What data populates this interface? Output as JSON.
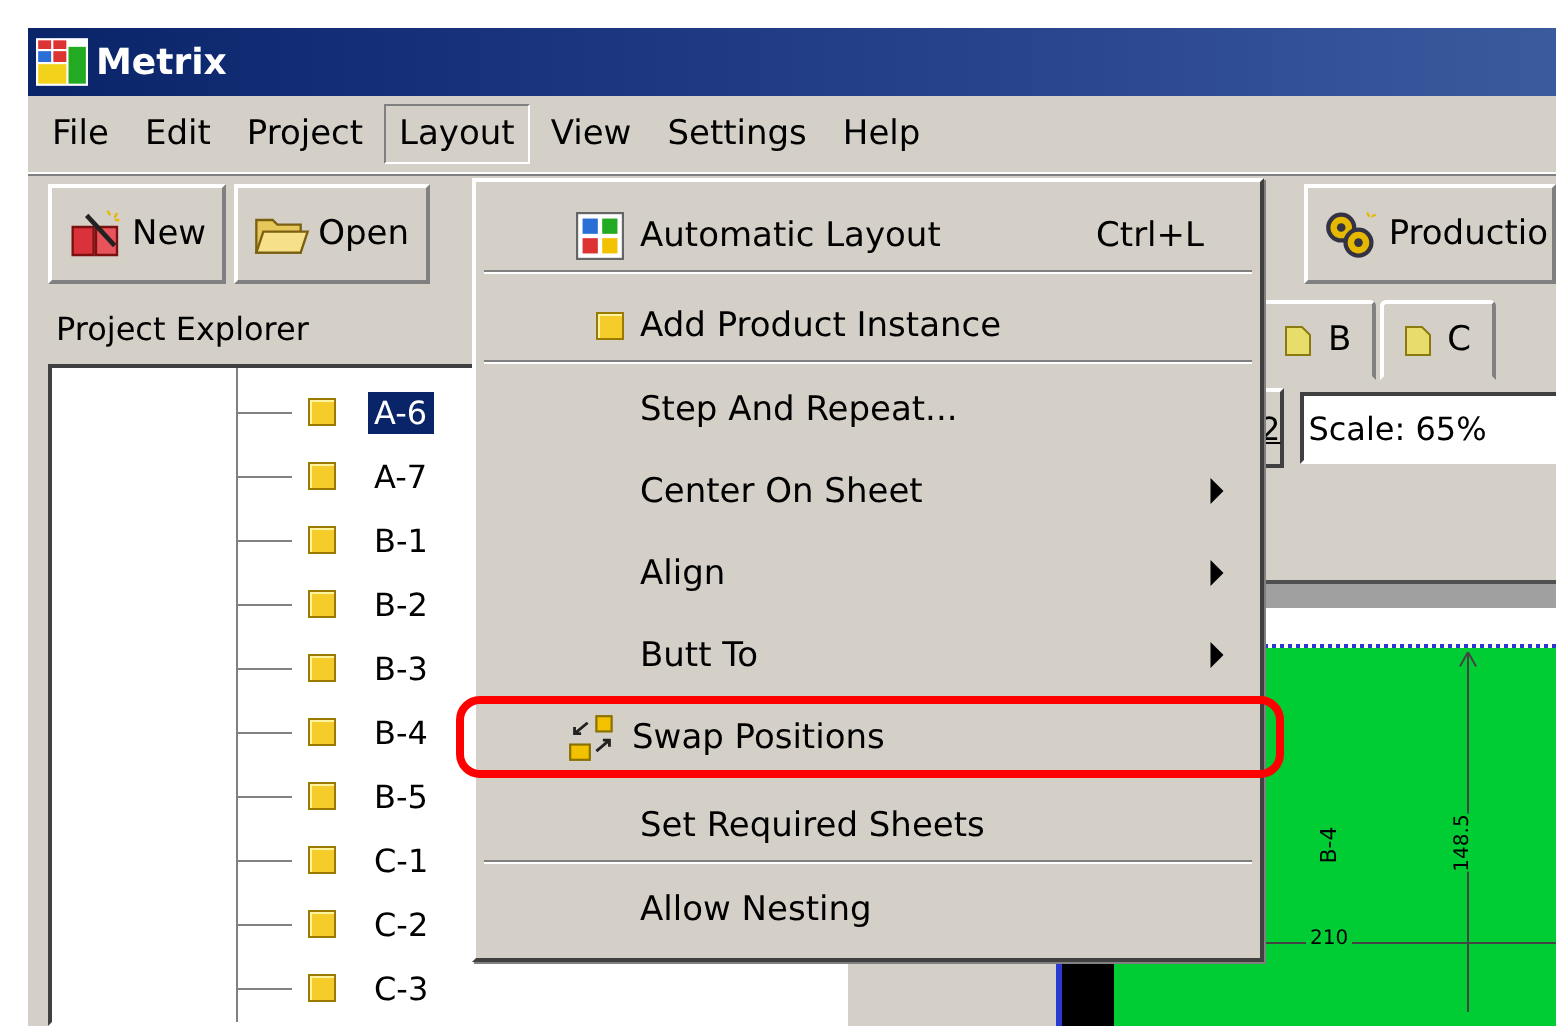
{
  "window": {
    "title": "Metrix"
  },
  "menu_bar": [
    {
      "label": "File",
      "selected": false
    },
    {
      "label": "Edit",
      "selected": false
    },
    {
      "label": "Project",
      "selected": false
    },
    {
      "label": "Layout",
      "selected": true
    },
    {
      "label": "View",
      "selected": false
    },
    {
      "label": "Settings",
      "selected": false
    },
    {
      "label": "Help",
      "selected": false
    }
  ],
  "toolbar": [
    {
      "label": "New",
      "kind": "new"
    },
    {
      "label": "Open",
      "kind": "open"
    },
    {
      "label": "Productio",
      "kind": "production"
    }
  ],
  "project_explorer": {
    "title": "Project Explorer",
    "items": [
      {
        "label": "A-6",
        "selected": true
      },
      {
        "label": "A-7",
        "selected": false
      },
      {
        "label": "B-1",
        "selected": false
      },
      {
        "label": "B-2",
        "selected": false
      },
      {
        "label": "B-3",
        "selected": false
      },
      {
        "label": "B-4",
        "selected": false
      },
      {
        "label": "B-5",
        "selected": false
      },
      {
        "label": "C-1",
        "selected": false
      },
      {
        "label": "C-2",
        "selected": false
      },
      {
        "label": "C-3",
        "selected": false
      }
    ]
  },
  "sheet_tabs": [
    {
      "label": "B"
    },
    {
      "label": "C"
    }
  ],
  "zoom_button": "2",
  "scale_field": {
    "value": "Scale: 65%"
  },
  "canvas": {
    "part_label": "B-4",
    "height_dimension": "148.5",
    "width_dimension": "210"
  },
  "layout_menu": {
    "items": [
      {
        "label": "Automatic Layout",
        "shortcut": "Ctrl+L",
        "kind": "automatic",
        "submenu": false,
        "highlighted": false,
        "separator_after": true
      },
      {
        "label": "Add Product Instance",
        "kind": "instance",
        "submenu": false,
        "highlighted": false,
        "separator_after": true
      },
      {
        "label": "Step And Repeat...",
        "kind": "plain",
        "submenu": false,
        "highlighted": false,
        "separator_after": false
      },
      {
        "label": "Center On Sheet",
        "kind": "plain",
        "submenu": true,
        "highlighted": false,
        "separator_after": false
      },
      {
        "label": "Align",
        "kind": "plain",
        "submenu": true,
        "highlighted": false,
        "separator_after": false
      },
      {
        "label": "Butt To",
        "kind": "plain",
        "submenu": true,
        "highlighted": false,
        "separator_after": false
      },
      {
        "label": "Swap Positions",
        "kind": "swap",
        "submenu": false,
        "highlighted": true,
        "separator_after": false
      },
      {
        "label": "Set Required Sheets",
        "kind": "plain",
        "submenu": false,
        "highlighted": false,
        "separator_after": true
      },
      {
        "label": "Allow Nesting",
        "kind": "plain",
        "submenu": false,
        "highlighted": false,
        "separator_after": false
      }
    ]
  }
}
